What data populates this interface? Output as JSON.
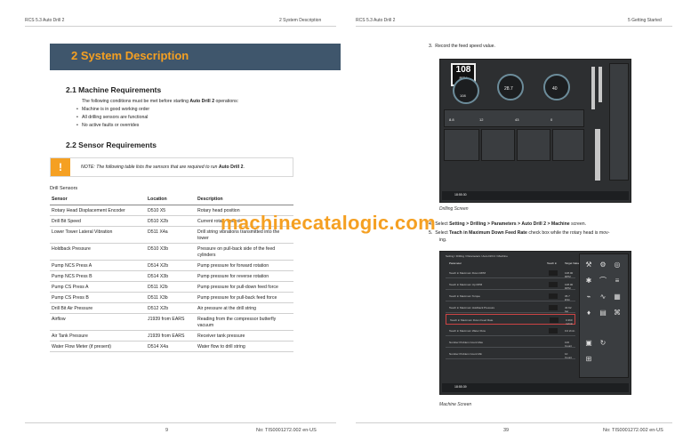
{
  "left": {
    "header": {
      "left": "RCS 5.3 Auto Drill 2",
      "right": "2 System Description"
    },
    "banner_title": "2 System Description",
    "section_21": {
      "title": "2.1 Machine Requirements",
      "intro_pre": "The following conditions must be met before starting ",
      "intro_bold": "Auto Drill 2",
      "intro_post": " operations:",
      "bullets": [
        "Machine is in good working order",
        "All drilling sensors are functional",
        "No active faults or overrides"
      ]
    },
    "section_22": {
      "title": "2.2 Sensor Requirements"
    },
    "note": {
      "icon": "!",
      "pre": "NOTE: The following table lists the sensors that are required to run ",
      "bold": "Auto Drill 2",
      "post": "."
    },
    "table_caption": "Drill Sensors",
    "table": {
      "headers": [
        "Sensor",
        "Location",
        "Description"
      ],
      "rows": [
        [
          "Rotary Head Displacement Encoder",
          "D510 X5",
          "Rotary head position"
        ],
        [
          "Drill Bit Speed",
          "D510 X2b",
          "Current rotary speed"
        ],
        [
          "Lower Tower Lateral Vibration",
          "D511 X4a",
          "Drill string vibrations transmitted into the tower"
        ],
        [
          "Holdback Pressure",
          "D510 X3b",
          "Pressure on pull-back side of the feed cylinders"
        ],
        [
          "Pump NCS Press A",
          "D514 X2b",
          "Pump pressure for forward rotation"
        ],
        [
          "Pump NCS Press B",
          "D514 X3b",
          "Pump pressure for reverse rotation"
        ],
        [
          "Pump CS Press A",
          "D511 X2b",
          "Pump pressure for pull-down feed force"
        ],
        [
          "Pump CS Press B",
          "D511 X3b",
          "Pump pressure for pull-back feed force"
        ],
        [
          "Drill Bit Air Pressure",
          "D512 X2b",
          "Air pressure at the drill string"
        ],
        [
          "Airflow",
          "J1939 from EARS",
          "Reading from the compressor butterfly vacuum"
        ],
        [
          "Air Tank Pressure",
          "J1939 from EARS",
          "Receiver tank pressure"
        ],
        [
          "Water Flow Meter (if present)",
          "D514 X4a",
          "Water flow to drill string"
        ]
      ]
    },
    "footer": {
      "page": "9",
      "doc": "No: TIS0001272.002 en-US"
    }
  },
  "watermark": "machinecatalogic.com",
  "right": {
    "header": {
      "left": "RCS 5.3 Auto Drill 2",
      "right": "5 Getting Started"
    },
    "step3": {
      "num": "3.",
      "text": "Record the feed speed value."
    },
    "drilling_screen": {
      "rpm_value": "108",
      "rpm_unit": "RPM",
      "gauge_values": [
        "108",
        "28.7",
        "40"
      ],
      "small_values": [
        "8.8",
        "12",
        "43",
        "0"
      ],
      "time": "18:55:30",
      "caption": "Drilling Screen"
    },
    "step4": {
      "num": "4.",
      "pre": "Select ",
      "b1": "Setting > Drilling > Parameters > Auto Drill 2 > Machine",
      "post": " screen."
    },
    "step5": {
      "num": "5.",
      "pre": "Select ",
      "b1": "Teach in Maximum Down Feed Rate",
      "post": " check box while the rotary head is mov-",
      "cont": "ing."
    },
    "machine_screen": {
      "tab_title": "Setting / Drilling / Parameters / Auto Drill 2 / Machine",
      "col_headers": [
        "Parameter",
        "Teach in",
        "Target Value"
      ],
      "rows": [
        {
          "label": "Teach in Maximum Down RPM",
          "value": "108.00 RPM"
        },
        {
          "label": "Teach in Maximum Up RPM",
          "value": "108.00 RPM"
        },
        {
          "label": "Teach in Maximum Torque",
          "value": "35.7 kNm"
        },
        {
          "label": "Teach in Maximum Holdback Pressure",
          "value": "40.92 bar"
        },
        {
          "label": "Teach in Maximum Down Feed Rate",
          "value": "0.360 m/min"
        },
        {
          "label": "Teach in Maximum Water Flow",
          "value": "0.0 l/min"
        },
        {
          "label": "Number Problem Count Max",
          "value": "100 Count"
        },
        {
          "label": "Number Problem Count Min",
          "value": "10 Count"
        }
      ],
      "time": "18:55:39",
      "caption": "Machine Screen"
    },
    "footer": {
      "page": "39",
      "doc": "No: TIS0001272.002 en-US"
    }
  }
}
